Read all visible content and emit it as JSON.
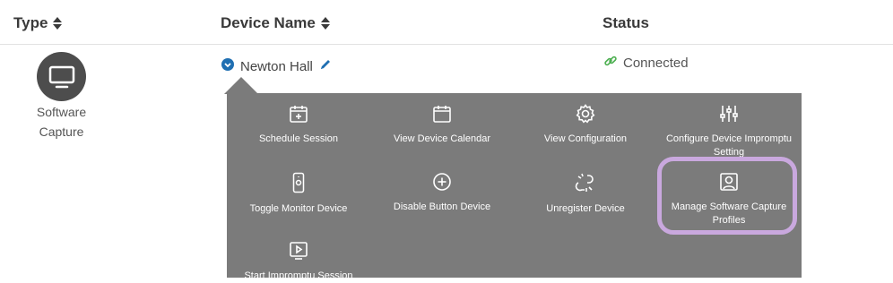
{
  "table": {
    "headers": {
      "type": "Type",
      "device_name": "Device Name",
      "status": "Status"
    },
    "row": {
      "type_label": "Software Capture",
      "device_name": "Newton Hall",
      "status": "Connected"
    }
  },
  "menu": {
    "items": [
      {
        "label": "Schedule Session",
        "icon": "calendar-plus-icon"
      },
      {
        "label": "View Device Calendar",
        "icon": "calendar-icon"
      },
      {
        "label": "View Configuration",
        "icon": "gear-icon"
      },
      {
        "label": "Configure Device Impromptu Setting",
        "icon": "sliders-icon"
      },
      {
        "label": "Toggle Monitor Device",
        "icon": "remote-icon"
      },
      {
        "label": "Disable Button Device",
        "icon": "plus-circle-icon"
      },
      {
        "label": "Unregister Device",
        "icon": "broken-link-icon"
      },
      {
        "label": "Manage Software Capture Profiles",
        "icon": "profile-icon"
      },
      {
        "label": "Start Impromptu Session",
        "icon": "play-screen-icon"
      }
    ]
  },
  "colors": {
    "menu_bg": "#7b7b7b",
    "highlight": "#c9a8de",
    "status_link": "#4caf50",
    "name_accent": "#1f6fb2"
  }
}
